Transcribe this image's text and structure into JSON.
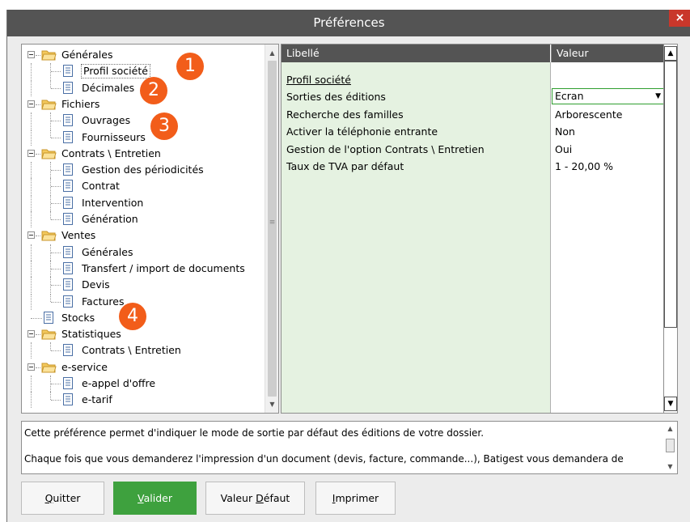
{
  "window": {
    "title": "Préférences",
    "close_label": "×"
  },
  "tree": {
    "items": [
      {
        "label": "Générales",
        "type": "folder",
        "level": 0,
        "expanded": true
      },
      {
        "label": "Profil société",
        "type": "page",
        "level": 1,
        "selected": true
      },
      {
        "label": "Décimales",
        "type": "page",
        "level": 1
      },
      {
        "label": "Fichiers",
        "type": "folder",
        "level": 0,
        "expanded": true
      },
      {
        "label": "Ouvrages",
        "type": "page",
        "level": 1
      },
      {
        "label": "Fournisseurs",
        "type": "page",
        "level": 1
      },
      {
        "label": "Contrats \\ Entretien",
        "type": "folder",
        "level": 0,
        "expanded": true
      },
      {
        "label": "Gestion des périodicités",
        "type": "page",
        "level": 1
      },
      {
        "label": "Contrat",
        "type": "page",
        "level": 1
      },
      {
        "label": "Intervention",
        "type": "page",
        "level": 1
      },
      {
        "label": "Génération",
        "type": "page",
        "level": 1
      },
      {
        "label": "Ventes",
        "type": "folder",
        "level": 0,
        "expanded": true
      },
      {
        "label": "Générales",
        "type": "page",
        "level": 1
      },
      {
        "label": "Transfert / import de documents",
        "type": "page",
        "level": 1
      },
      {
        "label": "Devis",
        "type": "page",
        "level": 1
      },
      {
        "label": "Factures",
        "type": "page",
        "level": 1
      },
      {
        "label": "Stocks",
        "type": "page",
        "level": 0
      },
      {
        "label": "Statistiques",
        "type": "folder",
        "level": 0,
        "expanded": true
      },
      {
        "label": "Contrats \\ Entretien",
        "type": "page",
        "level": 1
      },
      {
        "label": "e-service",
        "type": "folder",
        "level": 0,
        "expanded": true
      },
      {
        "label": "e-appel d'offre",
        "type": "page",
        "level": 1
      },
      {
        "label": "e-tarif",
        "type": "page",
        "level": 1
      }
    ]
  },
  "grid": {
    "columns": {
      "libelle": "Libellé",
      "valeur": "Valeur"
    },
    "section_title": "Profil société",
    "rows": [
      {
        "libelle": "Sorties des éditions",
        "valeur": "Ecran",
        "editing": true
      },
      {
        "libelle": "Recherche des familles",
        "valeur": "Arborescente"
      },
      {
        "libelle": "Activer la téléphonie entrante",
        "valeur": "Non"
      },
      {
        "libelle": "Gestion de l'option Contrats \\ Entretien",
        "valeur": "Oui"
      },
      {
        "libelle": "Taux de TVA par défaut",
        "valeur": "1 - 20,00 %"
      }
    ]
  },
  "description": {
    "line1": "Cette préférence permet d'indiquer le mode de sortie par défaut des éditions de votre dossier.",
    "line2": "Chaque fois que vous demanderez l'impression d'un document (devis, facture, commande...), Batigest vous demandera de"
  },
  "buttons": {
    "quit": "Quitter",
    "validate": "Valider",
    "default_value": "Valeur Défaut",
    "print": "Imprimer"
  },
  "badges": [
    "1",
    "2",
    "3",
    "4"
  ],
  "colors": {
    "titlebar": "#545454",
    "close": "#c9372b",
    "accent_green": "#3ea13e",
    "grid_label_bg": "#e5f2e1",
    "badge": "#f25d1a"
  },
  "icons": {
    "folder": "open-folder-icon",
    "page": "document-icon",
    "expander": "minus-expander-icon"
  }
}
